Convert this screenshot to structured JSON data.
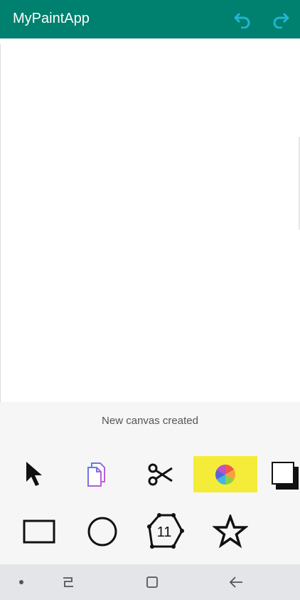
{
  "app": {
    "title": "MyPaintApp",
    "bar_color": "#00806e",
    "icon_color": "#1fb6d4"
  },
  "toolbar": {
    "actions": [
      {
        "name": "undo-icon"
      },
      {
        "name": "redo-icon"
      }
    ]
  },
  "status": {
    "message": "New canvas created"
  },
  "tools_row1": [
    {
      "name": "pointer-icon"
    },
    {
      "name": "copy-icon"
    },
    {
      "name": "scissors-icon"
    },
    {
      "name": "color-wheel-icon",
      "selected": true,
      "highlight": "#f5ec3a"
    },
    {
      "name": "fill-stroke-icon"
    }
  ],
  "tools_row2": [
    {
      "name": "rectangle-icon"
    },
    {
      "name": "circle-icon"
    },
    {
      "name": "polygon-icon",
      "sides_label": "11"
    },
    {
      "name": "star-icon"
    }
  ],
  "navigation": [
    {
      "name": "nav-dot-icon"
    },
    {
      "name": "recents-icon"
    },
    {
      "name": "home-icon"
    },
    {
      "name": "back-icon"
    }
  ]
}
